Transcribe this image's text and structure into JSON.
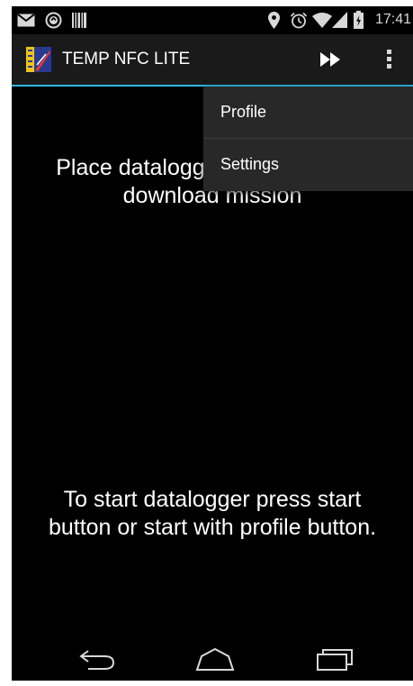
{
  "status_bar": {
    "time": "17:41",
    "left_icons": [
      "mail-icon",
      "sync-icon",
      "barcode-icon"
    ],
    "right_icons": [
      "location-icon",
      "alarm-icon",
      "wifi-icon",
      "signal-icon",
      "battery-icon"
    ]
  },
  "action_bar": {
    "title": "TEMP NFC LITE",
    "logo_icon": "app-logo-icon",
    "actions": [
      "fast-forward-icon",
      "overflow-menu-icon"
    ],
    "accent_color": "#33b5e5"
  },
  "main": {
    "top_message": "Place datalogger on antenna to download mission",
    "bottom_message": "To start datalogger press start button or start with profile button."
  },
  "menu": {
    "items": [
      {
        "label": "Profile"
      },
      {
        "label": "Settings"
      }
    ]
  },
  "nav_bar": {
    "buttons": [
      "back-icon",
      "home-icon",
      "recents-icon"
    ]
  }
}
